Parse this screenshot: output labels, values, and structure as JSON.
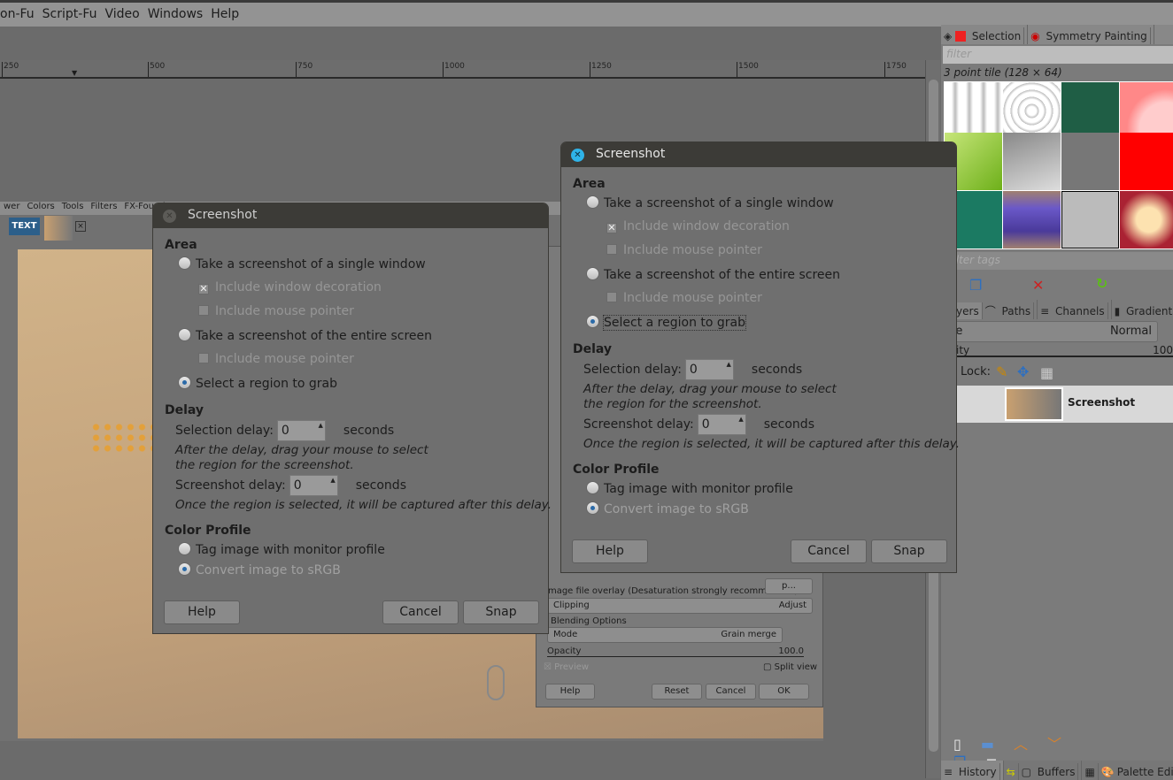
{
  "menubar": [
    "on-Fu",
    "Script-Fu",
    "Video",
    "Windows",
    "Help"
  ],
  "ruler": [
    "250",
    "500",
    "750",
    "1000",
    "1250",
    "1500",
    "1750"
  ],
  "inner_window": {
    "menu": [
      "wer",
      "Colors",
      "Tools",
      "Filters",
      "FX-Foundry"
    ],
    "tab_text_label": "TEXT"
  },
  "right_panel": {
    "top_tabs": [
      "Selection",
      "Symmetry Painting"
    ],
    "filter_placeholder": "filter",
    "pattern_name": "3 point tile (128 × 64)",
    "tags_placeholder": "filter tags",
    "layer_tabs": [
      "Layers",
      "Paths",
      "Channels",
      "Gradients"
    ],
    "mode_label": "Mode",
    "mode_value": "Normal",
    "opacity_label": "Opacity",
    "opacity_value": "100",
    "lock_label": "Lock:",
    "layer_name": "Screenshot",
    "bottom_tabs": [
      "History",
      "Buffers",
      "Palette Editor"
    ]
  },
  "filter_dialog": {
    "overlay_label": "Image file overlay (Desaturation strongly recommended)",
    "overlay_btn": "p...",
    "clipping_label": "Clipping",
    "clipping_value": "Adjust",
    "blending_title": "Blending Options",
    "mode_label": "Mode",
    "mode_value": "Grain merge",
    "opacity_label": "Opacity",
    "opacity_value": "100.0",
    "preview_label": "Preview",
    "split_label": "Split view",
    "buttons": [
      "Help",
      "Reset",
      "Cancel",
      "OK"
    ]
  },
  "dialogs": [
    {
      "title": "Screenshot",
      "area_heading": "Area",
      "single_window": "Take a screenshot of a single window",
      "include_decoration": "Include window decoration",
      "include_pointer": "Include mouse pointer",
      "entire_screen": "Take a screenshot of the entire screen",
      "include_pointer2": "Include mouse pointer",
      "region": "Select a region to grab",
      "delay_heading": "Delay",
      "selection_delay_label": "Selection delay:",
      "selection_delay_value": "0",
      "seconds1": "seconds",
      "hint1": "After the delay, drag your mouse to select",
      "hint2": "the region for the screenshot.",
      "screenshot_delay_label": "Screenshot delay:",
      "screenshot_delay_value": "0",
      "seconds2": "seconds",
      "hint3": "Once the region is selected, it will be captured after this delay.",
      "color_heading": "Color Profile",
      "tag_monitor": "Tag image with monitor profile",
      "convert_srgb": "Convert image to sRGB",
      "help": "Help",
      "cancel": "Cancel",
      "snap": "Snap"
    },
    {
      "title": "Screenshot",
      "area_heading": "Area",
      "single_window": "Take a screenshot of a single window",
      "include_decoration": "Include window decoration",
      "include_pointer": "Include mouse pointer",
      "entire_screen": "Take a screenshot of the entire screen",
      "include_pointer2": "Include mouse pointer",
      "region": "Select a region to grab",
      "delay_heading": "Delay",
      "selection_delay_label": "Selection delay:",
      "selection_delay_value": "0",
      "seconds1": "seconds",
      "hint1": "After the delay, drag your mouse to select",
      "hint2": "the region for the screenshot.",
      "screenshot_delay_label": "Screenshot delay:",
      "screenshot_delay_value": "0",
      "seconds2": "seconds",
      "hint3": "Once the region is selected, it will be captured after this delay.",
      "color_heading": "Color Profile",
      "tag_monitor": "Tag image with monitor profile",
      "convert_srgb": "Convert image to sRGB",
      "help": "Help",
      "cancel": "Cancel",
      "snap": "Snap"
    }
  ]
}
